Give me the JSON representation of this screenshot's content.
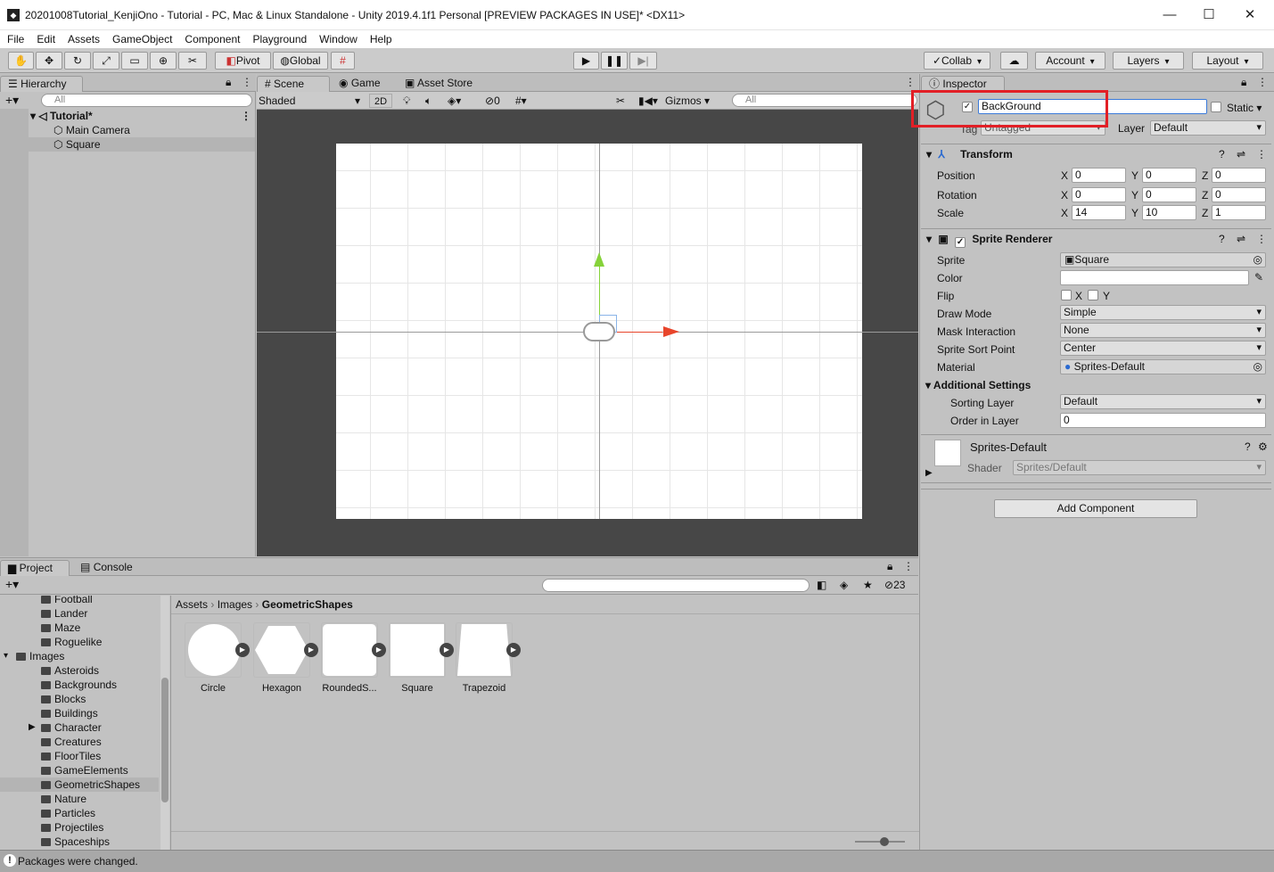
{
  "window": {
    "title": "20201008Tutorial_KenjiOno - Tutorial - PC, Mac & Linux Standalone - Unity 2019.4.1f1 Personal [PREVIEW PACKAGES IN USE]* <DX11>",
    "minimize": "—",
    "maximize": "☐",
    "close": "✕"
  },
  "menu": [
    "File",
    "Edit",
    "Assets",
    "GameObject",
    "Component",
    "Playground",
    "Window",
    "Help"
  ],
  "toolbar": {
    "pivot": "Pivot",
    "global": "Global",
    "collab": "Collab",
    "account": "Account",
    "layers": "Layers",
    "layout": "Layout"
  },
  "hierarchy": {
    "tab": "Hierarchy",
    "search_placeholder": "All",
    "scene": "Tutorial*",
    "items": [
      "Main Camera",
      "Square"
    ]
  },
  "scene": {
    "tabs": [
      "Scene",
      "Game",
      "Asset Store"
    ],
    "shading": "Shaded",
    "mode2d": "2D",
    "hidden_count": "0",
    "gizmos": "Gizmos",
    "search_placeholder": "All"
  },
  "inspector": {
    "tab": "Inspector",
    "object_name": "BackGround",
    "static_label": "Static",
    "tag_label": "Tag",
    "tag_value": "Untagged",
    "layer_label": "Layer",
    "layer_value": "Default",
    "transform": {
      "title": "Transform",
      "position_label": "Position",
      "rotation_label": "Rotation",
      "scale_label": "Scale",
      "position": {
        "x": "0",
        "y": "0",
        "z": "0"
      },
      "rotation": {
        "x": "0",
        "y": "0",
        "z": "0"
      },
      "scale": {
        "x": "14",
        "y": "10",
        "z": "1"
      }
    },
    "sprite_renderer": {
      "title": "Sprite Renderer",
      "sprite_label": "Sprite",
      "sprite_value": "Square",
      "color_label": "Color",
      "flip_label": "Flip",
      "flip_x": "X",
      "flip_y": "Y",
      "draw_mode_label": "Draw Mode",
      "draw_mode_value": "Simple",
      "mask_label": "Mask Interaction",
      "mask_value": "None",
      "sort_point_label": "Sprite Sort Point",
      "sort_point_value": "Center",
      "material_label": "Material",
      "material_value": "Sprites-Default",
      "additional_label": "Additional Settings",
      "sorting_layer_label": "Sorting Layer",
      "sorting_layer_value": "Default",
      "order_label": "Order in Layer",
      "order_value": "0"
    },
    "material": {
      "name": "Sprites-Default",
      "shader_label": "Shader",
      "shader_value": "Sprites/Default"
    },
    "add_component": "Add Component"
  },
  "project": {
    "tabs": [
      "Project",
      "Console"
    ],
    "hidden_count": "23",
    "breadcrumb": [
      "Assets",
      "Images",
      "GeometricShapes"
    ],
    "tree": [
      {
        "label": "Football",
        "indent": 2
      },
      {
        "label": "Lander",
        "indent": 2
      },
      {
        "label": "Maze",
        "indent": 2
      },
      {
        "label": "Roguelike",
        "indent": 2
      },
      {
        "label": "Images",
        "indent": 1
      },
      {
        "label": "Asteroids",
        "indent": 2
      },
      {
        "label": "Backgrounds",
        "indent": 2
      },
      {
        "label": "Blocks",
        "indent": 2
      },
      {
        "label": "Buildings",
        "indent": 2
      },
      {
        "label": "Character",
        "indent": 2
      },
      {
        "label": "Creatures",
        "indent": 2
      },
      {
        "label": "FloorTiles",
        "indent": 2
      },
      {
        "label": "GameElements",
        "indent": 2
      },
      {
        "label": "GeometricShapes",
        "indent": 2
      },
      {
        "label": "Nature",
        "indent": 2
      },
      {
        "label": "Particles",
        "indent": 2
      },
      {
        "label": "Projectiles",
        "indent": 2
      },
      {
        "label": "Spaceships",
        "indent": 2
      }
    ],
    "assets": [
      "Circle",
      "Hexagon",
      "RoundedS...",
      "Square",
      "Trapezoid"
    ]
  },
  "status": {
    "message": "Packages were changed."
  },
  "colors": {
    "highlight_box": "#e21f26",
    "scene_bg": "#474747",
    "axis_x": "#e8452b",
    "axis_y": "#86d23a"
  }
}
